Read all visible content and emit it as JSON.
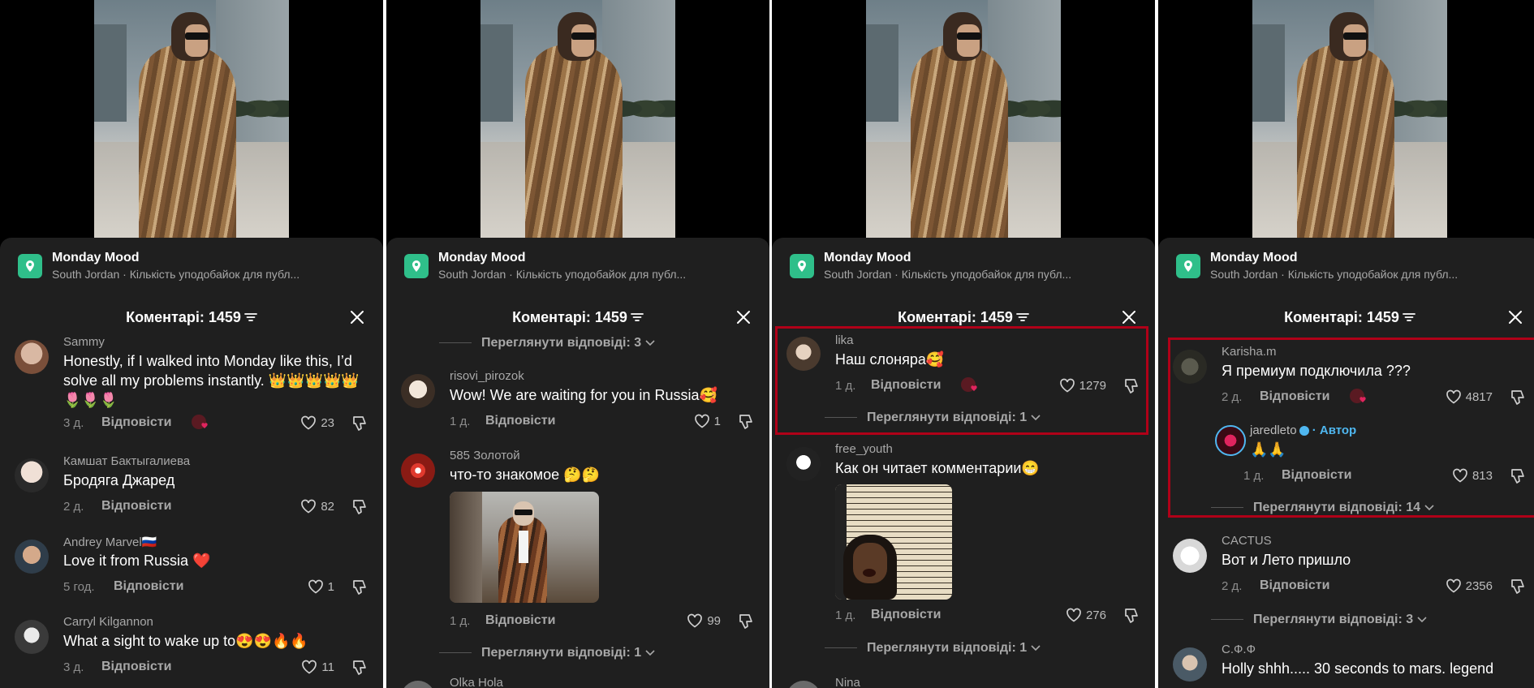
{
  "place": {
    "title": "Monday Mood",
    "subtitle": "South Jordan · Кількість уподобайок для публ..."
  },
  "header": {
    "title": "Коментарі: 1459"
  },
  "labels": {
    "reply": "Відповісти",
    "author": "· Автор"
  },
  "panel1": {
    "comments": [
      {
        "user": "Sammy",
        "text": "Honestly, if I walked into Monday like this, I’d solve all my problems instantly. 👑👑👑👑👑🌷🌷🌷",
        "time": "3 д.",
        "likes": "23"
      },
      {
        "user": "Камшат Бактыгалиева",
        "text": "Бродяга Джаред",
        "time": "2 д.",
        "likes": "82"
      },
      {
        "user": "Andrey Marvel🇷🇺",
        "text": "Love it from Russia ❤️",
        "time": "5 год.",
        "likes": "1"
      },
      {
        "user": "Carryl Kilgannon",
        "text": "What a sight to wake up to😍😍🔥🔥",
        "time": "3 д.",
        "likes": "11"
      }
    ]
  },
  "panel2": {
    "top_view_replies": "Переглянути відповіді: 3",
    "comments": [
      {
        "user": "risovi_pirozok",
        "text": "Wow! We are waiting for you in Russia🥰",
        "time": "1 д.",
        "likes": "1"
      },
      {
        "user": "585 Золотой",
        "text": "что-то знакомое 🤔🤔",
        "time": "1 д.",
        "likes": "99"
      }
    ],
    "view_replies": "Переглянути відповіді: 1",
    "next_user": "Olka Hola"
  },
  "panel3": {
    "comments": [
      {
        "user": "lika",
        "text": "Наш слоняра🥰",
        "time": "1 д.",
        "likes": "1279",
        "view_replies": "Переглянути відповіді: 1"
      },
      {
        "user": "free_youth",
        "text": "Как он читает комментарии😁",
        "time": "1 д.",
        "likes": "276",
        "view_replies": "Переглянути відповіді: 1"
      }
    ],
    "next_user": "Nina"
  },
  "panel4": {
    "comments": [
      {
        "user": "Karisha.m",
        "text": "Я премиум подключила ???",
        "time": "2 д.",
        "likes": "4817"
      },
      {
        "user": "CACTUS",
        "text": "Вот и Лето пришло",
        "time": "2 д.",
        "likes": "2356",
        "view_replies": "Переглянути відповіді: 3"
      },
      {
        "user": "С.Ф.Ф",
        "text": "Holly shhh..... 30 seconds to mars. legend"
      }
    ],
    "author_reply": {
      "user": "jaredleto",
      "text": "🙏🙏",
      "time": "1 д.",
      "likes": "813",
      "view_replies": "Переглянути відповіді: 14"
    }
  },
  "colors": {
    "highlight": "#b00018",
    "author": "#4fb7f0",
    "place_icon": "#2fbf8a"
  }
}
